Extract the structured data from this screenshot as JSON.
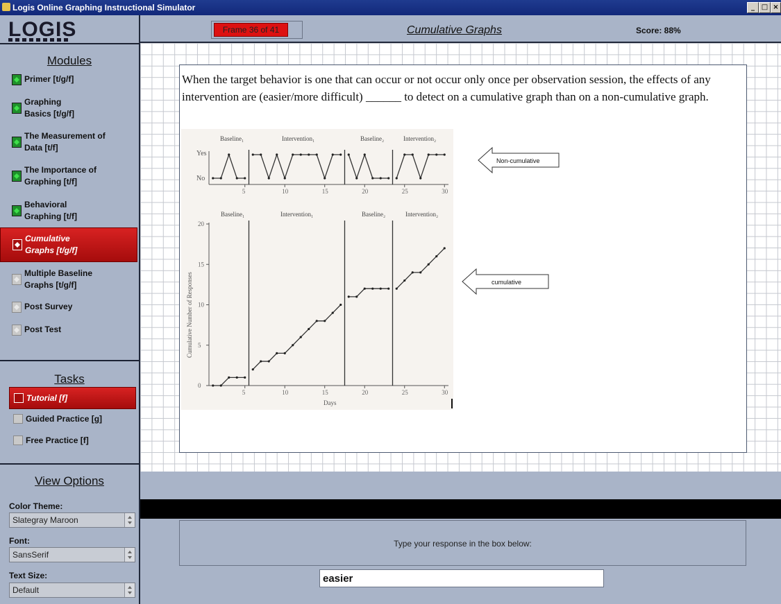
{
  "window": {
    "title": "Logis Online Graphing Instructional Simulator"
  },
  "logo": {
    "text": "LOGIS"
  },
  "header": {
    "frame": "Frame 36 of 41",
    "title": "Cumulative Graphs",
    "score": "Score: 88%"
  },
  "sidebar": {
    "modules_title": "Modules",
    "modules": [
      {
        "label_1": "Primer [t/g/f]",
        "label_2": ""
      },
      {
        "label_1": "Graphing",
        "label_2": "Basics [t/g/f]"
      },
      {
        "label_1": "The Measurement of",
        "label_2": "Data [t/f]"
      },
      {
        "label_1": "The Importance of",
        "label_2": "Graphing [t/f]"
      },
      {
        "label_1": "Behavioral",
        "label_2": "Graphing [t/f]"
      },
      {
        "label_1": "Cumulative",
        "label_2": "Graphs [t/g/f]"
      },
      {
        "label_1": "Multiple Baseline",
        "label_2": "Graphs [t/g/f]"
      },
      {
        "label_1": "Post Survey",
        "label_2": ""
      },
      {
        "label_1": "Post Test",
        "label_2": ""
      }
    ],
    "tasks_title": "Tasks",
    "tasks": [
      "Tutorial [f]",
      "Guided Practice [g]",
      "Free Practice [f]"
    ],
    "view_options_title": "View Options",
    "color_theme_label": "Color Theme:",
    "color_theme_value": "Slategray Maroon",
    "font_label": "Font:",
    "font_value": "SansSerif",
    "text_size_label": "Text Size:",
    "text_size_value": "Default"
  },
  "question": {
    "text": "When the target behavior is one that can occur or not occur only once per observation session, the effects of any intervention are (easier/more difficult) ______ to detect on a cumulative graph than on a non-cumulative graph."
  },
  "figure": {
    "top_phases": [
      "Baseline₁",
      "Intervention₁",
      "Baseline₂",
      "Intervention₂"
    ],
    "bottom_phases": [
      "Baseline₁",
      "Intervention₁",
      "Baseline₂",
      "Intervention₂"
    ],
    "yes_label": "Yes",
    "no_label": "No",
    "x_ticks": [
      "5",
      "10",
      "15",
      "20",
      "25",
      "30"
    ],
    "y_ticks": [
      "0",
      "5",
      "10",
      "15",
      "20"
    ],
    "y_axis_label": "Cumulative Number of Responses",
    "x_axis_label": "Days",
    "callout_top": "Non-cumulative",
    "callout_bottom": "cumulative"
  },
  "chart_data": [
    {
      "type": "line",
      "x": [
        1,
        2,
        3,
        4,
        5,
        6,
        7,
        8,
        9,
        10,
        11,
        12,
        13,
        14,
        15,
        16,
        17,
        18,
        19,
        20,
        21,
        22,
        23,
        24,
        25,
        26,
        27,
        28,
        29,
        30
      ],
      "values": [
        0,
        0,
        1,
        0,
        0,
        1,
        1,
        0,
        1,
        0,
        1,
        1,
        1,
        1,
        0,
        1,
        1,
        1,
        0,
        1,
        0,
        0,
        0,
        0,
        1,
        1,
        0,
        1,
        1,
        1
      ],
      "phase_changes_after": [
        5,
        17,
        23
      ]
    },
    {
      "type": "line",
      "x": [
        1,
        2,
        3,
        4,
        5,
        6,
        7,
        8,
        9,
        10,
        11,
        12,
        13,
        14,
        15,
        16,
        17,
        18,
        19,
        20,
        21,
        22,
        23,
        24,
        25,
        26,
        27,
        28,
        29,
        30
      ],
      "values": [
        0,
        0,
        1,
        1,
        1,
        2,
        3,
        3,
        4,
        4,
        5,
        6,
        7,
        8,
        8,
        9,
        10,
        11,
        11,
        12,
        12,
        12,
        12,
        12,
        13,
        14,
        14,
        15,
        16,
        17
      ],
      "ylim": [
        0,
        20
      ],
      "ylabel": "Cumulative Number of Responses",
      "xlabel": "Days",
      "phase_changes_after": [
        5,
        17,
        23
      ]
    }
  ],
  "response": {
    "prompt": "Type your response in the box below:",
    "value": "easier"
  }
}
